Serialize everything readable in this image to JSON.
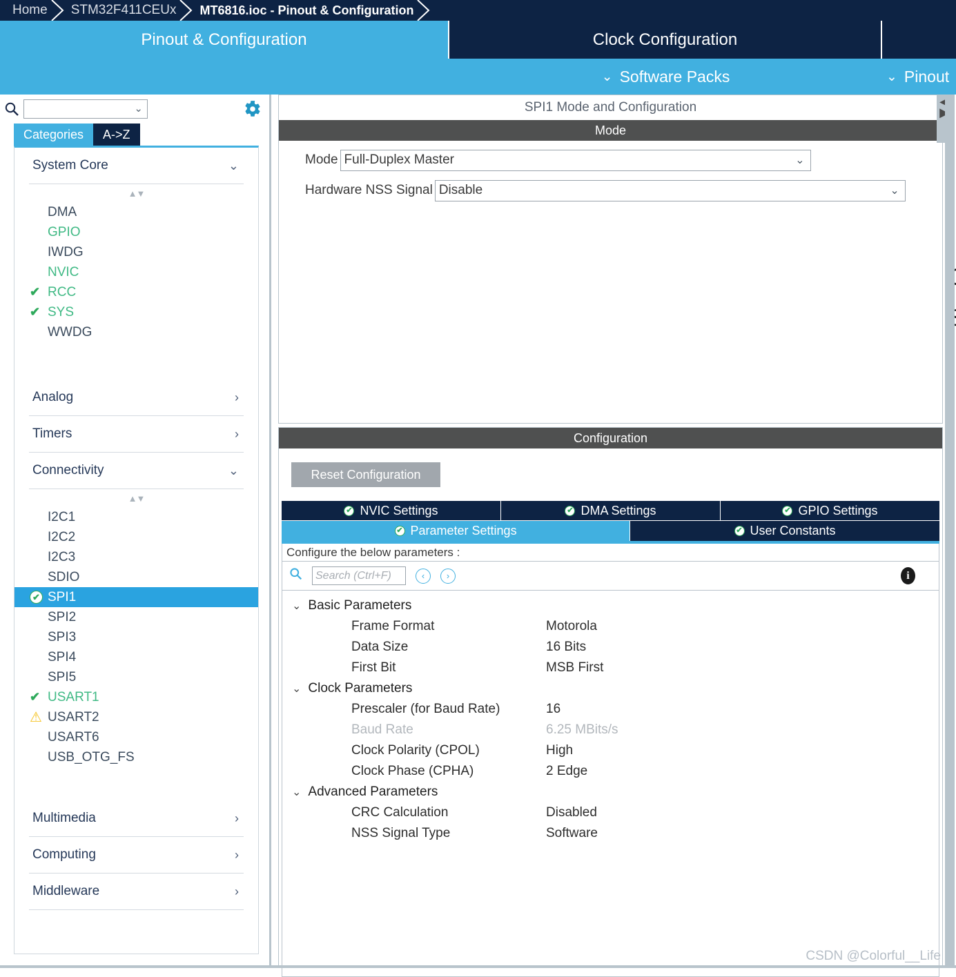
{
  "breadcrumb": {
    "items": [
      {
        "label": "Home",
        "active": false
      },
      {
        "label": "STM32F411CEUx",
        "active": false
      },
      {
        "label": "MT6816.ioc - Pinout & Configuration",
        "active": true
      }
    ]
  },
  "main_tabs": [
    {
      "label": "Pinout & Configuration",
      "selected": true
    },
    {
      "label": "Clock Configuration",
      "selected": false
    },
    {
      "label": "",
      "selected": false
    }
  ],
  "subbar": {
    "software_packs": "Software Packs",
    "pinout": "Pinout",
    "chevron": "⌄"
  },
  "left_panel": {
    "search": {
      "value": "",
      "placeholder": ""
    },
    "gear_tooltip": "Settings",
    "category_tabs": [
      {
        "label": "Categories",
        "selected": true
      },
      {
        "label": "A->Z",
        "selected": false
      }
    ],
    "groups": [
      {
        "name": "System Core",
        "expanded": true,
        "items": [
          {
            "label": "DMA",
            "state": "none"
          },
          {
            "label": "GPIO",
            "state": "green"
          },
          {
            "label": "IWDG",
            "state": "none"
          },
          {
            "label": "NVIC",
            "state": "green"
          },
          {
            "label": "RCC",
            "state": "check"
          },
          {
            "label": "SYS",
            "state": "check"
          },
          {
            "label": "WWDG",
            "state": "none"
          }
        ]
      },
      {
        "name": "Analog",
        "expanded": false,
        "items": []
      },
      {
        "name": "Timers",
        "expanded": false,
        "items": []
      },
      {
        "name": "Connectivity",
        "expanded": true,
        "items": [
          {
            "label": "I2C1",
            "state": "none"
          },
          {
            "label": "I2C2",
            "state": "none"
          },
          {
            "label": "I2C3",
            "state": "none"
          },
          {
            "label": "SDIO",
            "state": "none"
          },
          {
            "label": "SPI1",
            "state": "selected-ok"
          },
          {
            "label": "SPI2",
            "state": "none"
          },
          {
            "label": "SPI3",
            "state": "none"
          },
          {
            "label": "SPI4",
            "state": "none"
          },
          {
            "label": "SPI5",
            "state": "none"
          },
          {
            "label": "USART1",
            "state": "check"
          },
          {
            "label": "USART2",
            "state": "warn"
          },
          {
            "label": "USART6",
            "state": "none"
          },
          {
            "label": "USB_OTG_FS",
            "state": "none"
          }
        ]
      },
      {
        "name": "Multimedia",
        "expanded": false,
        "items": []
      },
      {
        "name": "Computing",
        "expanded": false,
        "items": []
      },
      {
        "name": "Middleware",
        "expanded": false,
        "items": []
      }
    ]
  },
  "right_panel": {
    "peripheral_title": "SPI1 Mode and Configuration",
    "mode_section": {
      "header": "Mode",
      "fields": [
        {
          "label": "Mode",
          "value": "Full-Duplex Master"
        },
        {
          "label": "Hardware NSS Signal",
          "value": "Disable"
        }
      ]
    },
    "configuration_section": {
      "header": "Configuration",
      "reset_button": "Reset Configuration",
      "tabs_row1": [
        {
          "label": "NVIC Settings",
          "selected": false
        },
        {
          "label": "DMA Settings",
          "selected": false
        },
        {
          "label": "GPIO Settings",
          "selected": false
        }
      ],
      "tabs_row2": [
        {
          "label": "Parameter Settings",
          "selected": true
        },
        {
          "label": "User Constants",
          "selected": false
        }
      ],
      "hint": "Configure the below parameters :",
      "search": {
        "value": "",
        "placeholder": "Search (Ctrl+F)"
      },
      "nav_prev": "‹",
      "nav_next": "›",
      "info": "i",
      "parameters": [
        {
          "type": "group",
          "label": "Basic Parameters"
        },
        {
          "type": "param",
          "label": "Frame Format",
          "value": "Motorola",
          "dim": false
        },
        {
          "type": "param",
          "label": "Data Size",
          "value": "16 Bits",
          "dim": false
        },
        {
          "type": "param",
          "label": "First Bit",
          "value": "MSB First",
          "dim": false
        },
        {
          "type": "group",
          "label": "Clock Parameters"
        },
        {
          "type": "param",
          "label": "Prescaler (for Baud Rate)",
          "value": "16",
          "dim": false
        },
        {
          "type": "param",
          "label": "Baud Rate",
          "value": "6.25 MBits/s",
          "dim": true
        },
        {
          "type": "param",
          "label": "Clock Polarity (CPOL)",
          "value": "High",
          "dim": false
        },
        {
          "type": "param",
          "label": "Clock Phase (CPHA)",
          "value": "2 Edge",
          "dim": false
        },
        {
          "type": "group",
          "label": "Advanced Parameters"
        },
        {
          "type": "param",
          "label": "CRC Calculation",
          "value": "Disabled",
          "dim": false
        },
        {
          "type": "param",
          "label": "NSS Signal Type",
          "value": "Software",
          "dim": false
        }
      ]
    },
    "clipped_right_text": [
      "C",
      "S"
    ]
  },
  "watermark": "CSDN @Colorful__Life",
  "colors": {
    "brand_dark": "#0d2344",
    "brand_light": "#41b0e0",
    "band_gray": "#4f5050",
    "border_gray": "#b8c4cc",
    "ok_green": "#2faa5c",
    "warn_yellow": "#f5c323",
    "green_text": "#3fb984"
  }
}
